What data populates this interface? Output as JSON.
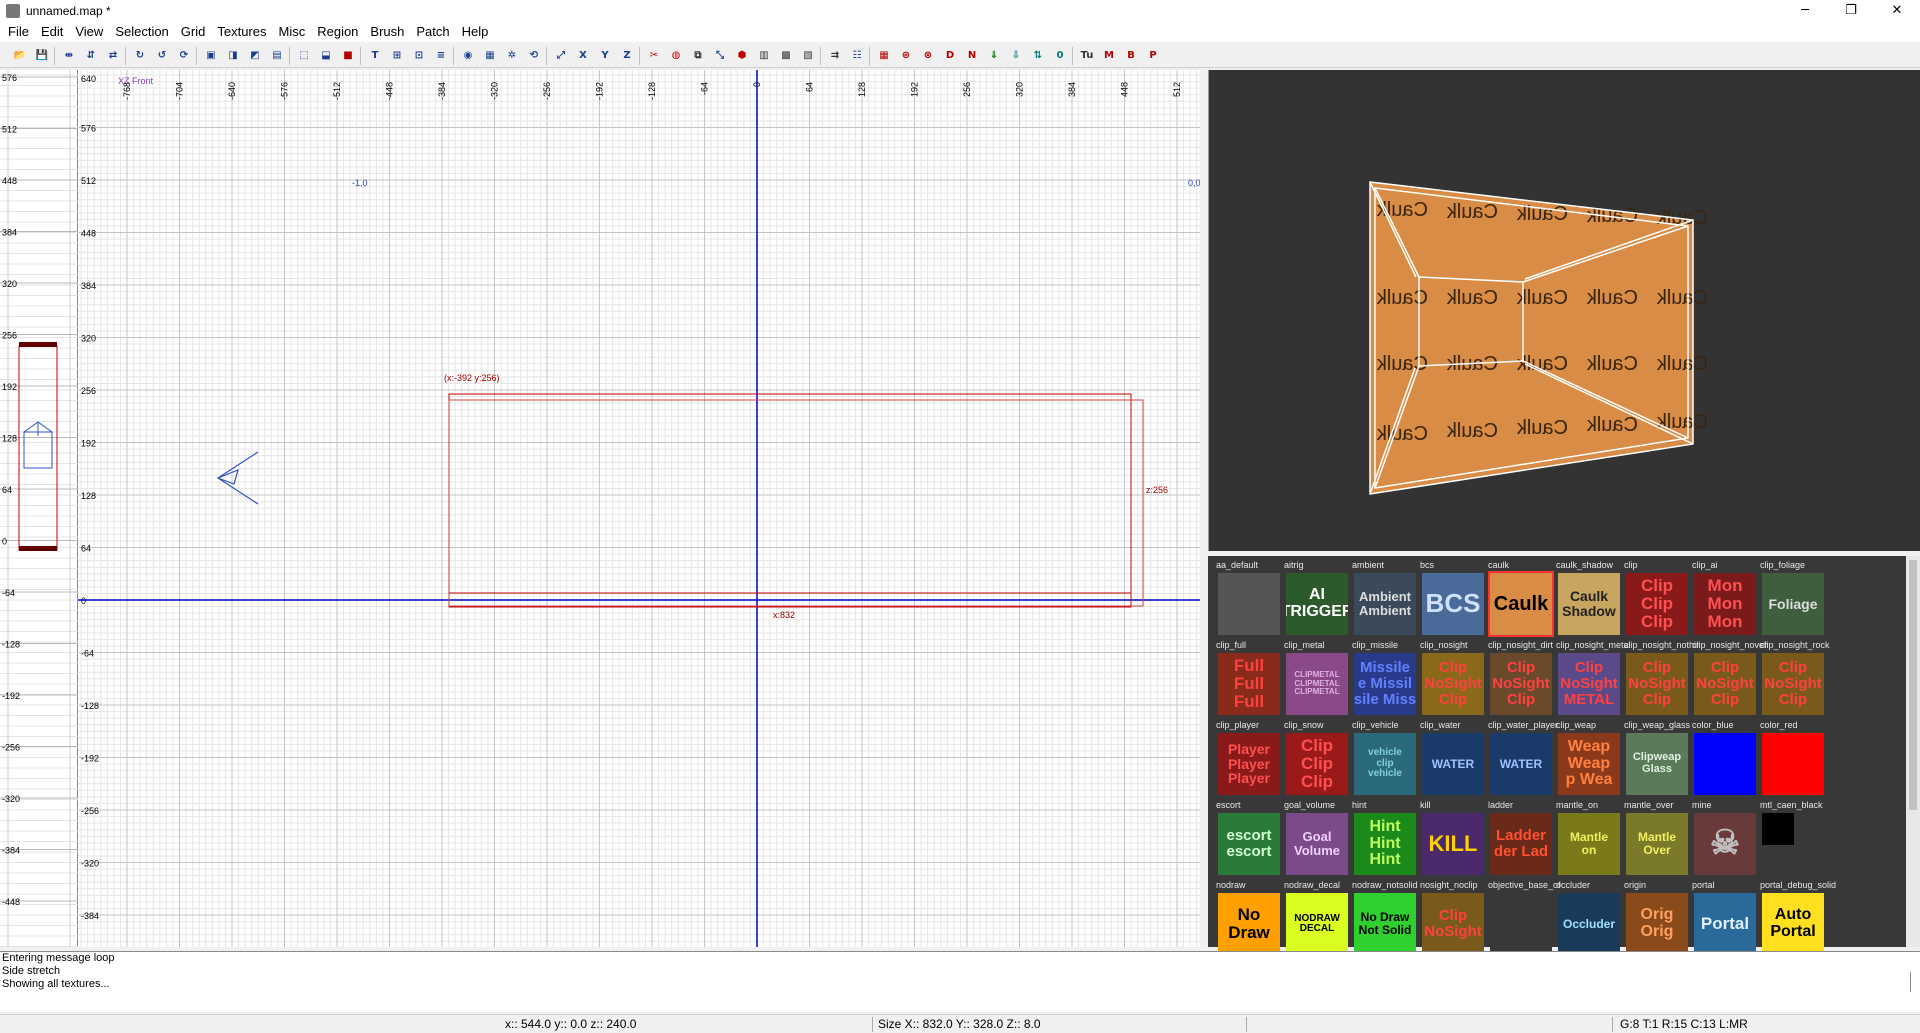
{
  "window": {
    "title": "unnamed.map *",
    "minimize": "─",
    "maximize": "❐",
    "close": "✕"
  },
  "menu": [
    "File",
    "Edit",
    "View",
    "Selection",
    "Grid",
    "Textures",
    "Misc",
    "Region",
    "Brush",
    "Patch",
    "Help"
  ],
  "toolbar": {
    "buttons": [
      {
        "name": "open",
        "glyph": "📂",
        "color": "#b08000"
      },
      {
        "name": "save",
        "glyph": "💾",
        "color": "#333"
      },
      {
        "name": "flip-x",
        "glyph": "⇹",
        "color": "#1a3d8f"
      },
      {
        "name": "flip-y",
        "glyph": "⇵",
        "color": "#1a3d8f"
      },
      {
        "name": "flip-z",
        "glyph": "⇄",
        "color": "#1a3d8f"
      },
      {
        "name": "rotate-x",
        "glyph": "↻",
        "color": "#1a3d8f"
      },
      {
        "name": "rotate-y",
        "glyph": "↺",
        "color": "#1a3d8f"
      },
      {
        "name": "rotate-z",
        "glyph": "⟳",
        "color": "#1a3d8f"
      },
      {
        "name": "csg-hollow",
        "glyph": "▣",
        "color": "#1a3d8f"
      },
      {
        "name": "csg-subtract",
        "glyph": "◨",
        "color": "#1a3d8f"
      },
      {
        "name": "csg-merge",
        "glyph": "◩",
        "color": "#1a3d8f"
      },
      {
        "name": "csg-make-room",
        "glyph": "▤",
        "color": "#1a3d8f"
      },
      {
        "name": "select-touching",
        "glyph": "⬚",
        "color": "#1a3d8f"
      },
      {
        "name": "select-partial",
        "glyph": "⬓",
        "color": "#1a3d8f"
      },
      {
        "name": "select-complete",
        "glyph": "■",
        "color": "#b00000"
      },
      {
        "name": "texture-lock",
        "glyph": "T",
        "color": "#1a3d8f"
      },
      {
        "name": "texture-fit",
        "glyph": "⊞",
        "color": "#1a3d8f"
      },
      {
        "name": "texture-cycle",
        "glyph": "⊡",
        "color": "#1a3d8f"
      },
      {
        "name": "texture-layers",
        "glyph": "≡",
        "color": "#1a3d8f"
      },
      {
        "name": "filter",
        "glyph": "◉",
        "color": "#1a3d8f"
      },
      {
        "name": "camera",
        "glyph": "▦",
        "color": "#1a3d8f"
      },
      {
        "name": "camera-mode",
        "glyph": "✲",
        "color": "#1a3d8f"
      },
      {
        "name": "view-change",
        "glyph": "⟲",
        "color": "#1a3d8f"
      },
      {
        "name": "zoom-fit",
        "glyph": "⤢",
        "color": "#1a3d8f"
      },
      {
        "name": "view-x",
        "glyph": "X",
        "color": "#1a3d8f"
      },
      {
        "name": "view-y",
        "glyph": "Y",
        "color": "#1a3d8f"
      },
      {
        "name": "view-z",
        "glyph": "Z",
        "color": "#1a3d8f"
      },
      {
        "name": "clipper",
        "glyph": "✂",
        "color": "#c00000"
      },
      {
        "name": "patch-bend",
        "glyph": "◍",
        "color": "#c00000"
      },
      {
        "name": "patch-insert",
        "glyph": "⧉",
        "color": "#333"
      },
      {
        "name": "patch-delete",
        "glyph": "⤡",
        "color": "#1a3d8f"
      },
      {
        "name": "patch-cap",
        "glyph": "⬢",
        "color": "#c00000"
      },
      {
        "name": "patch-thicken",
        "glyph": "▥",
        "color": "#333"
      },
      {
        "name": "patch-weld",
        "glyph": "▩",
        "color": "#333"
      },
      {
        "name": "patch-drill",
        "glyph": "▧",
        "color": "#333"
      },
      {
        "name": "entity-list",
        "glyph": "⇉",
        "color": "#333"
      },
      {
        "name": "show-entities",
        "glyph": "☷",
        "color": "#1a3d8f"
      },
      {
        "name": "show-models",
        "glyph": "▦",
        "color": "#b00000"
      },
      {
        "name": "show-paths",
        "glyph": "⊛",
        "color": "#b00000"
      },
      {
        "name": "show-spawners",
        "glyph": "⊗",
        "color": "#b00000"
      },
      {
        "name": "show-d",
        "glyph": "D",
        "color": "#b00000"
      },
      {
        "name": "show-n",
        "glyph": "N",
        "color": "#b00000"
      },
      {
        "name": "arrow-down-green",
        "glyph": "⇓",
        "color": "#007000"
      },
      {
        "name": "arrow-down-cyan",
        "glyph": "⇩",
        "color": "#007a7a"
      },
      {
        "name": "ladder",
        "glyph": "⇅",
        "color": "#007a7a"
      },
      {
        "name": "zero",
        "glyph": "0",
        "color": "#007a7a"
      },
      {
        "name": "tool-tu",
        "glyph": "Tu",
        "color": "#333"
      },
      {
        "name": "tool-m",
        "glyph": "M",
        "color": "#b00000"
      },
      {
        "name": "tool-b",
        "glyph": "B",
        "color": "#b00000"
      },
      {
        "name": "tool-p",
        "glyph": "P",
        "color": "#b00000"
      }
    ]
  },
  "zview": {
    "ticks": [
      "576",
      "512",
      "448",
      "384",
      "320",
      "256",
      "192",
      "128",
      "64",
      "0",
      "-64",
      "-128",
      "-192",
      "-256",
      "-320",
      "-384",
      "-448"
    ]
  },
  "xzview": {
    "label": "XZ Front",
    "top_ticks": [
      "-768",
      "-704",
      "-640",
      "-576",
      "-512",
      "-448",
      "-384",
      "-320",
      "-256",
      "-192",
      "-128",
      "-64",
      "0",
      "64",
      "128",
      "192",
      "256",
      "320",
      "384",
      "448",
      "512"
    ],
    "left_ticks": [
      "576",
      "512",
      "448",
      "384",
      "320",
      "256",
      "192",
      "128",
      "64",
      "0",
      "-64",
      "-128",
      "-192",
      "-256",
      "-320",
      "-384"
    ],
    "corner_label": "640",
    "marker_left": "-1,0",
    "marker_right": "0,0",
    "selection_label": "(x:-392  y:256)",
    "size_z_label": "z:256",
    "size_x_label": "x:832"
  },
  "camera": {
    "caulk_text": "Caulk",
    "colors": {
      "caulk": "#d98c45",
      "wire": "#ffffff"
    }
  },
  "textures": [
    {
      "name": "aa_default",
      "lines": [
        ""
      ],
      "bg": "#555555",
      "fg": "#888",
      "size": 10,
      "selected": false
    },
    {
      "name": "aitrig",
      "lines": [
        "AI",
        "TRIGGER"
      ],
      "bg": "#2d5a2d",
      "fg": "#fff",
      "size": 16,
      "selected": false
    },
    {
      "name": "ambient",
      "lines": [
        "Ambient",
        "Ambient"
      ],
      "bg": "#3a4a5a",
      "fg": "#ddd",
      "size": 13,
      "selected": false
    },
    {
      "name": "bcs",
      "lines": [
        "BCS"
      ],
      "bg": "#4a6a9a",
      "fg": "#cfe0ff",
      "size": 26,
      "selected": false
    },
    {
      "name": "caulk",
      "lines": [
        "Caulk"
      ],
      "bg": "#d98c45",
      "fg": "#000",
      "size": 20,
      "selected": true
    },
    {
      "name": "caulk_shadow",
      "lines": [
        "Caulk",
        "Shadow"
      ],
      "bg": "#c8a660",
      "fg": "#222",
      "size": 14,
      "selected": false
    },
    {
      "name": "clip",
      "lines": [
        "Clip",
        "Clip",
        "Clip"
      ],
      "bg": "#8a1a1a",
      "fg": "#ff5050",
      "size": 17,
      "selected": false
    },
    {
      "name": "clip_ai",
      "lines": [
        "Mon",
        "Mon",
        "Mon"
      ],
      "bg": "#7a1a1a",
      "fg": "#ff5050",
      "size": 17,
      "selected": false
    },
    {
      "name": "clip_foliage",
      "lines": [
        "Foliage"
      ],
      "bg": "#3e5e3e",
      "fg": "#ddd",
      "size": 14,
      "selected": false
    },
    {
      "name": "clip_full",
      "lines": [
        "Full",
        "Full",
        "Full"
      ],
      "bg": "#8a2a1a",
      "fg": "#ff4040",
      "size": 17,
      "selected": false
    },
    {
      "name": "clip_metal",
      "lines": [
        "CLIPMETAL",
        "CLIPMETAL",
        "CLIPMETAL"
      ],
      "bg": "#8a4a8a",
      "fg": "#e0b0e0",
      "size": 8,
      "selected": false
    },
    {
      "name": "clip_missile",
      "lines": [
        "Missile",
        "e Missil",
        "sile Miss"
      ],
      "bg": "#2a3a8a",
      "fg": "#6080ff",
      "size": 15,
      "selected": false
    },
    {
      "name": "clip_nosight",
      "lines": [
        "Clip",
        "NoSight",
        "Clip"
      ],
      "bg": "#8a6a1a",
      "fg": "#ff4040",
      "size": 15,
      "selected": false
    },
    {
      "name": "clip_nosight_dirt",
      "lines": [
        "Clip",
        "NoSight",
        "Clip"
      ],
      "bg": "#6a4a2a",
      "fg": "#ff4040",
      "size": 15,
      "selected": false
    },
    {
      "name": "clip_nosight_metal",
      "lines": [
        "Clip",
        "NoSight",
        "METAL"
      ],
      "bg": "#5a4a8a",
      "fg": "#ff4040",
      "size": 15,
      "selected": false
    },
    {
      "name": "clip_nosight_nothing",
      "lines": [
        "Clip",
        "NoSight",
        "Clip"
      ],
      "bg": "#7a5a1a",
      "fg": "#ff4040",
      "size": 15,
      "selected": false
    },
    {
      "name": "clip_nosight_novehicle",
      "lines": [
        "Clip",
        "NoSight",
        "Clip"
      ],
      "bg": "#7a5a1a",
      "fg": "#ff4040",
      "size": 15,
      "selected": false
    },
    {
      "name": "clip_nosight_rock",
      "lines": [
        "Clip",
        "NoSight",
        "Clip"
      ],
      "bg": "#7a5a1a",
      "fg": "#ff4040",
      "size": 15,
      "selected": false
    },
    {
      "name": "clip_player",
      "lines": [
        "Player",
        "Player",
        "Player"
      ],
      "bg": "#8a1a1a",
      "fg": "#ff5050",
      "size": 14,
      "selected": false
    },
    {
      "name": "clip_snow",
      "lines": [
        "Clip",
        "Clip",
        "Clip"
      ],
      "bg": "#9a1a1a",
      "fg": "#ff5050",
      "size": 17,
      "selected": false
    },
    {
      "name": "clip_vehicle",
      "lines": [
        "vehicle",
        "clip",
        "vehicle"
      ],
      "bg": "#2a6a7a",
      "fg": "#80d0e0",
      "size": 10,
      "selected": false
    },
    {
      "name": "clip_water",
      "lines": [
        "WATER"
      ],
      "bg": "#1a3a6a",
      "fg": "#a0c0ff",
      "size": 12,
      "selected": false
    },
    {
      "name": "clip_water_player",
      "lines": [
        "WATER"
      ],
      "bg": "#1a3a6a",
      "fg": "#a0c0ff",
      "size": 12,
      "selected": false
    },
    {
      "name": "clip_weap",
      "lines": [
        "Weap",
        "Weap",
        "p Wea"
      ],
      "bg": "#8a3a1a",
      "fg": "#ff8040",
      "size": 16,
      "selected": false
    },
    {
      "name": "clip_weap_glass",
      "lines": [
        "Clipweap",
        "Glass"
      ],
      "bg": "#5a7a5a",
      "fg": "#e0f0e0",
      "size": 11,
      "selected": false
    },
    {
      "name": "color_blue",
      "lines": [
        ""
      ],
      "bg": "#0000ff",
      "fg": "#fff",
      "size": 10,
      "selected": false
    },
    {
      "name": "color_red",
      "lines": [
        ""
      ],
      "bg": "#ff0000",
      "fg": "#fff",
      "size": 10,
      "selected": false
    },
    {
      "name": "escort",
      "lines": [
        "escort",
        "escort"
      ],
      "bg": "#2a7a3a",
      "fg": "#d0ffd0",
      "size": 15,
      "selected": false
    },
    {
      "name": "goal_volume",
      "lines": [
        "Goal",
        "Volume"
      ],
      "bg": "#7a4a8a",
      "fg": "#f0d0ff",
      "size": 13,
      "selected": false
    },
    {
      "name": "hint",
      "lines": [
        "Hint",
        "Hint",
        "Hint"
      ],
      "bg": "#1a8a1a",
      "fg": "#c0ff60",
      "size": 16,
      "selected": false
    },
    {
      "name": "kill",
      "lines": [
        "KILL"
      ],
      "bg": "#4a2a6a",
      "fg": "#ffd000",
      "size": 22,
      "selected": false
    },
    {
      "name": "ladder",
      "lines": [
        "Ladder",
        "der Lad"
      ],
      "bg": "#6a2a1a",
      "fg": "#ff5030",
      "size": 15,
      "selected": false
    },
    {
      "name": "mantle_on",
      "lines": [
        "Mantle",
        "on"
      ],
      "bg": "#7a7a1a",
      "fg": "#f0f060",
      "size": 12,
      "selected": false
    },
    {
      "name": "mantle_over",
      "lines": [
        "Mantle",
        "Over"
      ],
      "bg": "#7a7a2a",
      "fg": "#f0f060",
      "size": 12,
      "selected": false
    },
    {
      "name": "mine",
      "lines": [
        "☠"
      ],
      "bg": "#6a3a3a",
      "fg": "#c0c0c0",
      "size": 34,
      "selected": false
    },
    {
      "name": "mtl_caen_black",
      "lines": [
        ""
      ],
      "bg": "#000000",
      "fg": "#fff",
      "size": 10,
      "selected": false
    },
    {
      "name": "nodraw",
      "lines": [
        "No",
        "Draw"
      ],
      "bg": "#ffa000",
      "fg": "#000",
      "size": 17,
      "selected": false
    },
    {
      "name": "nodraw_decal",
      "lines": [
        "NODRAW",
        "DECAL"
      ],
      "bg": "#d8ff20",
      "fg": "#000",
      "size": 10,
      "selected": false
    },
    {
      "name": "nodraw_notsolid",
      "lines": [
        "No Draw",
        "Not Solid"
      ],
      "bg": "#30d030",
      "fg": "#000",
      "size": 12,
      "selected": false
    },
    {
      "name": "nosight_noclip",
      "lines": [
        "Clip",
        "NoSight"
      ],
      "bg": "#7a5a1a",
      "fg": "#ff4040",
      "size": 15,
      "selected": false
    },
    {
      "name": "objective_base_of",
      "lines": [
        ""
      ],
      "bg": "#383838",
      "fg": "#fff",
      "size": 10,
      "selected": false
    },
    {
      "name": "occluder",
      "lines": [
        "Occluder"
      ],
      "bg": "#1a3a5a",
      "fg": "#a0e0ff",
      "size": 12,
      "selected": false
    },
    {
      "name": "origin",
      "lines": [
        "Orig",
        "Orig"
      ],
      "bg": "#8a4a1a",
      "fg": "#ffa060",
      "size": 16,
      "selected": false
    },
    {
      "name": "portal",
      "lines": [
        "Portal"
      ],
      "bg": "#2a6a9a",
      "fg": "#e0f0ff",
      "size": 17,
      "selected": false
    },
    {
      "name": "portal_debug_solid",
      "lines": [
        "Auto",
        "Portal"
      ],
      "bg": "#ffe020",
      "fg": "#000",
      "size": 16,
      "selected": false
    }
  ],
  "console": {
    "lines": [
      "Entering message loop",
      "Side stretch",
      "Showing all textures..."
    ]
  },
  "status": {
    "coords": "x:: 544.0  y:: 0.0  z:: 240.0",
    "size": "Size X:: 832.0  Y:: 328.0  Z:: 8.0",
    "grid": "G:8 T:1 R:15 C:13 L:MR"
  }
}
